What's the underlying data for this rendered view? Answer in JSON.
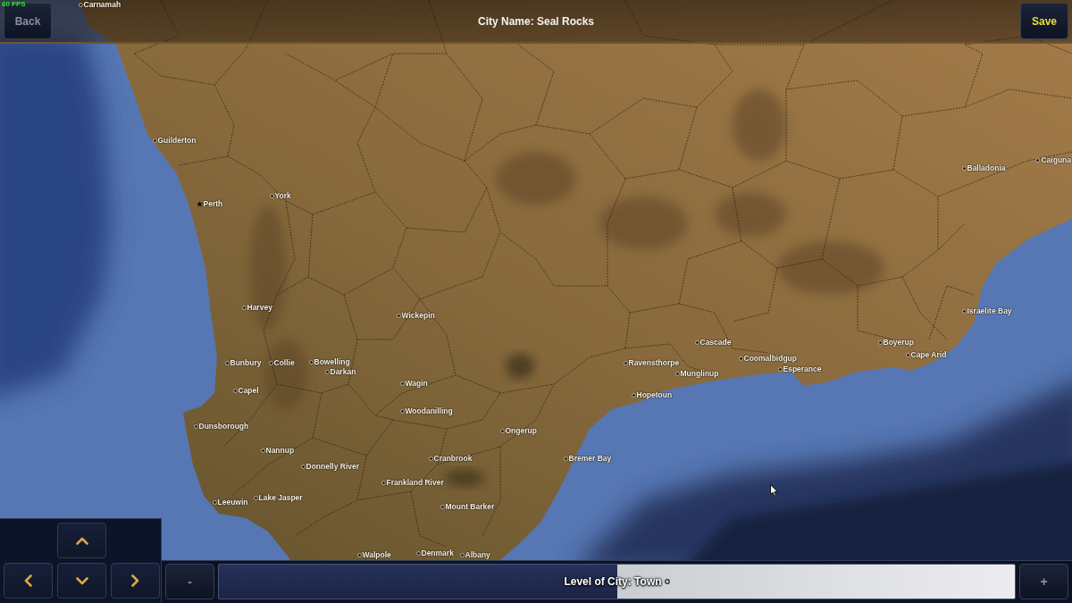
{
  "fps_counter": "60 FPS",
  "top_bar": {
    "back_button": {
      "label": "Back",
      "disabled": true
    },
    "title": "City Name: Seal Rocks",
    "save_button": {
      "label": "Save",
      "disabled": false
    }
  },
  "map": {
    "cities": [
      {
        "name": "Carnamah",
        "kind": "town"
      },
      {
        "name": "Guilderton",
        "kind": "town"
      },
      {
        "name": "Caiguna",
        "kind": "town"
      },
      {
        "name": "Balladonia",
        "kind": "town"
      },
      {
        "name": "York",
        "kind": "town"
      },
      {
        "name": "Perth",
        "kind": "capital"
      },
      {
        "name": "Harvey",
        "kind": "town"
      },
      {
        "name": "Israelite Bay",
        "kind": "town"
      },
      {
        "name": "Wickepin",
        "kind": "town"
      },
      {
        "name": "Cascade",
        "kind": "town"
      },
      {
        "name": "Boyerup",
        "kind": "town"
      },
      {
        "name": "Cape Arid",
        "kind": "town"
      },
      {
        "name": "Coomalbidgup",
        "kind": "town"
      },
      {
        "name": "Bunbury",
        "kind": "town"
      },
      {
        "name": "Collie",
        "kind": "town"
      },
      {
        "name": "Bowelling",
        "kind": "town"
      },
      {
        "name": "Ravensthorpe",
        "kind": "town"
      },
      {
        "name": "Darkan",
        "kind": "town"
      },
      {
        "name": "Esperance",
        "kind": "town"
      },
      {
        "name": "Munglinup",
        "kind": "town"
      },
      {
        "name": "Wagin",
        "kind": "town"
      },
      {
        "name": "Capel",
        "kind": "town"
      },
      {
        "name": "Hopetoun",
        "kind": "town"
      },
      {
        "name": "Woodanilling",
        "kind": "town"
      },
      {
        "name": "Dunsborough",
        "kind": "town"
      },
      {
        "name": "Ongerup",
        "kind": "town"
      },
      {
        "name": "Nannup",
        "kind": "town"
      },
      {
        "name": "Cranbrook",
        "kind": "town"
      },
      {
        "name": "Bremer Bay",
        "kind": "town"
      },
      {
        "name": "Donnelly River",
        "kind": "town"
      },
      {
        "name": "Frankland River",
        "kind": "town"
      },
      {
        "name": "Lake Jasper",
        "kind": "town"
      },
      {
        "name": "Leeuwin",
        "kind": "town"
      },
      {
        "name": "Mount Barker",
        "kind": "town"
      },
      {
        "name": "Walpole",
        "kind": "town"
      },
      {
        "name": "Denmark",
        "kind": "town"
      },
      {
        "name": "Albany",
        "kind": "town"
      }
    ]
  },
  "dpad": [
    {
      "kind": "up"
    },
    {
      "kind": "left"
    },
    {
      "kind": "down"
    },
    {
      "kind": "right"
    }
  ],
  "level_bar": {
    "minus_button": {
      "label": "-",
      "disabled": true
    },
    "slider": {
      "label": "Level of City: Town",
      "level": 0.5
    },
    "plus_button": {
      "label": "+",
      "disabled": true
    }
  }
}
